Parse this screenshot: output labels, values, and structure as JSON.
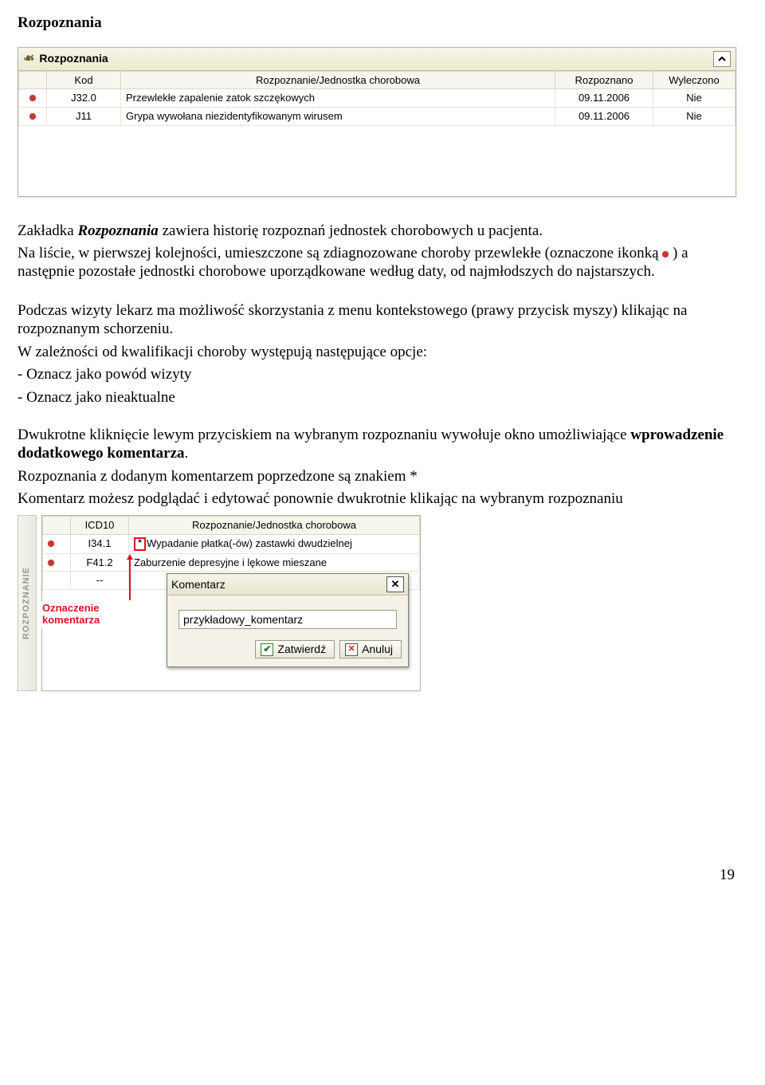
{
  "section_title": "Rozpoznania",
  "panel1": {
    "title": "Rozpoznania",
    "columns": {
      "code": "Kod",
      "diag": "Rozpoznanie/Jednostka chorobowa",
      "date": "Rozpoznano",
      "cured": "Wyleczono"
    },
    "rows": [
      {
        "code": "J32.0",
        "diag": "Przewlekłe zapalenie zatok szczękowych",
        "date": "09.11.2006",
        "cured": "Nie"
      },
      {
        "code": "J11",
        "diag": "Grypa wywołana niezidentyfikowanym wirusem",
        "date": "09.11.2006",
        "cured": "Nie"
      }
    ]
  },
  "par": {
    "p1a": "Zakładka ",
    "p1b": "Rozpoznania",
    "p1c": " zawiera historię rozpoznań jednostek chorobowych u pacjenta.",
    "p2a": "Na liście, w pierwszej kolejności, umieszczone są zdiagnozowane choroby przewlekłe (oznaczone ikonką ",
    "p2b": " ) a następnie pozostałe jednostki chorobowe uporządkowane według daty, od najmłodszych do najstarszych.",
    "p3": "Podczas wizyty lekarz ma możliwość skorzystania z menu kontekstowego (prawy przycisk myszy) klikając na rozpoznanym schorzeniu.",
    "p4": "W zależności od kwalifikacji choroby występują następujące opcje:",
    "opt1": "- Oznacz jako powód wizyty",
    "opt2": "- Oznacz jako nieaktualne",
    "p5a": "Dwukrotne kliknięcie lewym przyciskiem na wybranym rozpoznaniu wywołuje okno umożliwiające ",
    "p5b": "wprowadzenie dodatkowego komentarza",
    "p5c": ".",
    "p6": "Rozpoznania z dodanym komentarzem poprzedzone są znakiem *",
    "p7": "Komentarz możesz podglądać i edytować ponownie dwukrotnie klikając na wybranym rozpoznaniu"
  },
  "panel2": {
    "sidebar": "ROZPOZNANIE",
    "columns": {
      "code": "ICD10",
      "diag": "Rozpoznanie/Jednostka chorobowa"
    },
    "rows": [
      {
        "code": "I34.1",
        "star": "*",
        "diag": "Wypadanie płatka(-ów) zastawki dwudzielnej"
      },
      {
        "code": "F41.2",
        "star": "",
        "diag": "Zaburzenie depresyjne i lękowe mieszane"
      },
      {
        "code": "--",
        "star": "",
        "diag": ""
      }
    ],
    "annotation_line1": "Oznaczenie",
    "annotation_line2": "komentarza"
  },
  "dialog": {
    "title": "Komentarz",
    "input_value": "przykładowy_komentarz",
    "btn_ok": "Zatwierdź",
    "btn_cancel": "Anuluj"
  },
  "page_number": "19"
}
